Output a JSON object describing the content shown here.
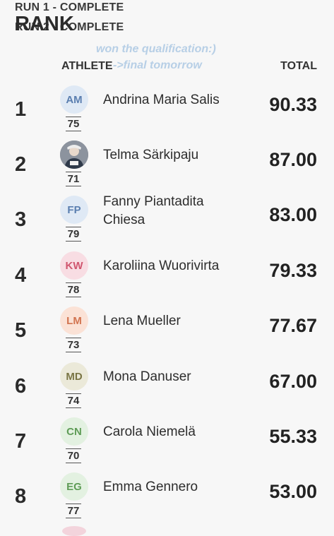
{
  "status": {
    "run1": "RUN 1 - COMPLETE",
    "run2": "RUN 2 - COMPLETE"
  },
  "note": {
    "line1": "won the qualification:)",
    "line2": "->final tomorrow"
  },
  "table": {
    "headers": {
      "rank": "RANK",
      "athlete": "ATHLETE",
      "total": "TOTAL"
    },
    "rows": [
      {
        "rank": "1",
        "initials": "AM",
        "bib": "75",
        "name": "Andrina Maria Salis",
        "total": "90.33",
        "avatar_bg": "#dfe9f5",
        "avatar_fg": "#5b7fb0"
      },
      {
        "rank": "2",
        "initials": "",
        "bib": "71",
        "name": "Telma Särkipaju",
        "total": "87.00",
        "avatar_bg": "#5d6470",
        "avatar_fg": "#ffffff",
        "photo": "profile-photo"
      },
      {
        "rank": "3",
        "initials": "FP",
        "bib": "79",
        "name": "Fanny Piantadita\nChiesa",
        "total": "83.00",
        "avatar_bg": "#dfe9f5",
        "avatar_fg": "#5b7fb0"
      },
      {
        "rank": "4",
        "initials": "KW",
        "bib": "78",
        "name": "Karoliina Wuorivirta",
        "total": "79.33",
        "avatar_bg": "#f8dde3",
        "avatar_fg": "#d0566f"
      },
      {
        "rank": "5",
        "initials": "LM",
        "bib": "73",
        "name": "Lena Mueller",
        "total": "77.67",
        "avatar_bg": "#fbe2d6",
        "avatar_fg": "#d27450"
      },
      {
        "rank": "6",
        "initials": "MD",
        "bib": "74",
        "name": "Mona Danuser",
        "total": "67.00",
        "avatar_bg": "#ebe9d9",
        "avatar_fg": "#7a7545"
      },
      {
        "rank": "7",
        "initials": "CN",
        "bib": "70",
        "name": "Carola Niemelä",
        "total": "55.33",
        "avatar_bg": "#e3f1e1",
        "avatar_fg": "#5f9c57"
      },
      {
        "rank": "8",
        "initials": "EG",
        "bib": "77",
        "name": "Emma Gennero",
        "total": "53.00",
        "avatar_bg": "#e3f1e1",
        "avatar_fg": "#5f9c57"
      }
    ]
  }
}
